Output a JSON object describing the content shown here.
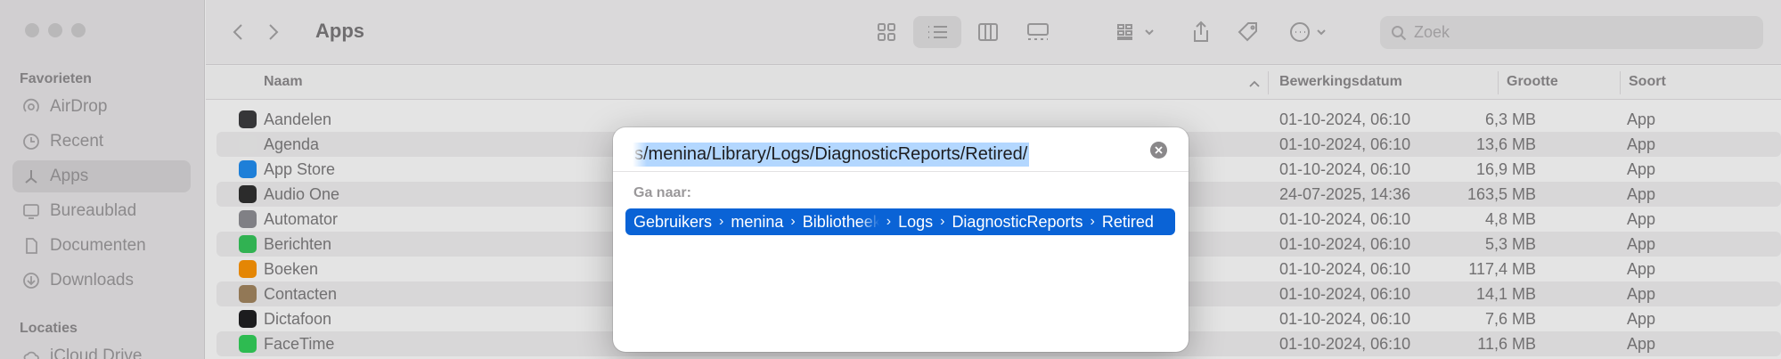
{
  "window": {
    "title": "Apps"
  },
  "sidebar": {
    "sections": [
      {
        "title": "Favorieten",
        "items": [
          {
            "label": "AirDrop",
            "icon": "airdrop-icon"
          },
          {
            "label": "Recent",
            "icon": "clock-icon"
          },
          {
            "label": "Apps",
            "icon": "apps-icon",
            "selected": true
          },
          {
            "label": "Bureaublad",
            "icon": "desktop-icon"
          },
          {
            "label": "Documenten",
            "icon": "document-icon"
          },
          {
            "label": "Downloads",
            "icon": "download-icon"
          }
        ]
      },
      {
        "title": "Locaties",
        "items": [
          {
            "label": "iCloud Drive",
            "icon": "cloud-icon"
          }
        ]
      }
    ]
  },
  "toolbar": {
    "search_placeholder": "Zoek",
    "view_selected": "list"
  },
  "columns": {
    "name": "Naam",
    "date": "Bewerkingsdatum",
    "size": "Grootte",
    "kind": "Soort"
  },
  "files": [
    {
      "name": "Aandelen",
      "date": "01-10-2024, 06:10",
      "size": "6,3 MB",
      "kind": "App",
      "color": "#3a3a3c"
    },
    {
      "name": "Agenda",
      "date": "01-10-2024, 06:10",
      "size": "13,6 MB",
      "kind": "App",
      "color": "#f2f2f2"
    },
    {
      "name": "App Store",
      "date": "01-10-2024, 06:10",
      "size": "16,9 MB",
      "kind": "App",
      "color": "#1e8cf2"
    },
    {
      "name": "Audio One",
      "date": "24-07-2025, 14:36",
      "size": "163,5 MB",
      "kind": "App",
      "color": "#2d2d2d"
    },
    {
      "name": "Automator",
      "date": "01-10-2024, 06:10",
      "size": "4,8 MB",
      "kind": "App",
      "color": "#8e8e93"
    },
    {
      "name": "Berichten",
      "date": "01-10-2024, 06:10",
      "size": "5,3 MB",
      "kind": "App",
      "color": "#34c759"
    },
    {
      "name": "Boeken",
      "date": "01-10-2024, 06:10",
      "size": "117,4 MB",
      "kind": "App",
      "color": "#ff9500"
    },
    {
      "name": "Contacten",
      "date": "01-10-2024, 06:10",
      "size": "14,1 MB",
      "kind": "App",
      "color": "#a2845e"
    },
    {
      "name": "Dictafoon",
      "date": "01-10-2024, 06:10",
      "size": "7,6 MB",
      "kind": "App",
      "color": "#1c1c1e"
    },
    {
      "name": "FaceTime",
      "date": "01-10-2024, 06:10",
      "size": "11,6 MB",
      "kind": "App",
      "color": "#30d158"
    }
  ],
  "goto_dialog": {
    "path_value": "s/menina/Library/Logs/DiagnosticReports/Retired/",
    "section_label": "Ga naar:",
    "suggestion": [
      "Gebruikers",
      "menina",
      "Bibliotheek",
      "Logs",
      "DiagnosticReports",
      "Retired"
    ],
    "highlight_color": "#0a63d6",
    "selection_color": "#b3d7ff"
  }
}
